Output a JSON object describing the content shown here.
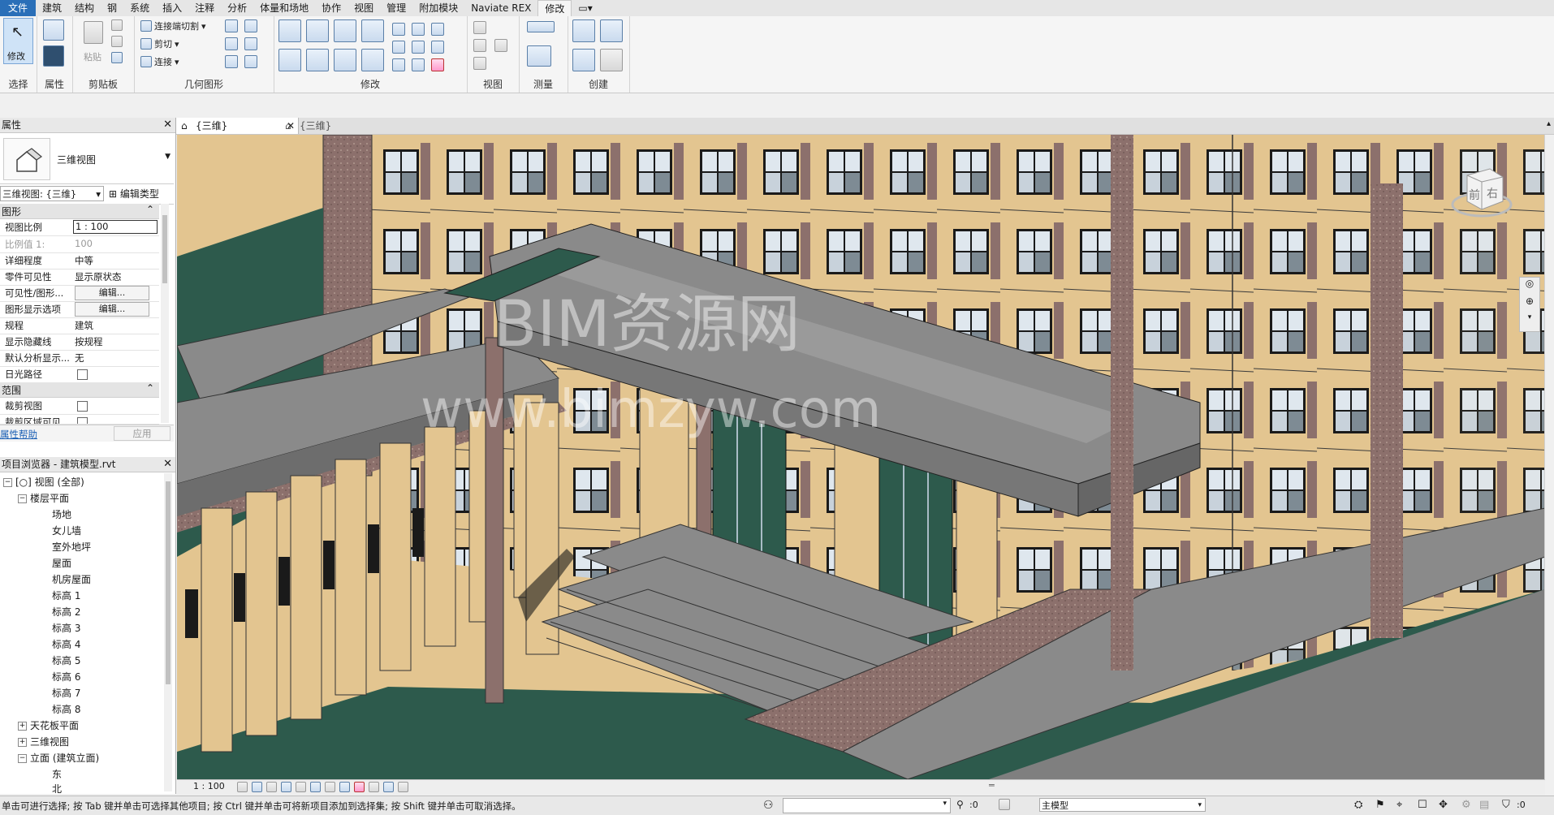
{
  "menu_tabs": [
    "文件",
    "建筑",
    "结构",
    "钢",
    "系统",
    "插入",
    "注释",
    "分析",
    "体量和场地",
    "协作",
    "视图",
    "管理",
    "附加模块",
    "Naviate REX",
    "修改"
  ],
  "ribbon": {
    "panels": {
      "select": "选择",
      "properties": "属性",
      "clipboard": "剪贴板",
      "geometry": "几何图形",
      "modify": "修改",
      "view": "视图",
      "measure": "测量",
      "create": "创建"
    },
    "modify_button": "修改",
    "paste_label": "粘贴",
    "cope": "连接端切割",
    "cut": "剪切",
    "join": "连接"
  },
  "properties_panel": {
    "title": "属性",
    "type_name": "三维视图",
    "type_selector": "三维视图: {三维}",
    "edit_type": "编辑类型",
    "section_graphics": "图形",
    "section_range": "范围",
    "rows": [
      {
        "key": "视图比例",
        "value": "1 : 100"
      },
      {
        "key": "比例值 1:",
        "value": "100"
      },
      {
        "key": "详细程度",
        "value": "中等"
      },
      {
        "key": "零件可见性",
        "value": "显示原状态"
      },
      {
        "key": "可见性/图形...",
        "value": "编辑..."
      },
      {
        "key": "图形显示选项",
        "value": "编辑..."
      },
      {
        "key": "规程",
        "value": "建筑"
      },
      {
        "key": "显示隐藏线",
        "value": "按规程"
      },
      {
        "key": "默认分析显示...",
        "value": "无"
      },
      {
        "key": "日光路径",
        "value": ""
      }
    ],
    "range_rows": [
      {
        "key": "裁剪视图"
      },
      {
        "key": "裁剪区域可见"
      }
    ],
    "help_link": "属性帮助",
    "apply": "应用"
  },
  "project_browser": {
    "title": "项目浏览器 - 建筑模型.rvt",
    "root": "视图 (全部)",
    "floor_plans": "楼层平面",
    "floor_items": [
      "场地",
      "女儿墙",
      "室外地坪",
      "屋面",
      "机房屋面",
      "标高 1",
      "标高 2",
      "标高 3",
      "标高 4",
      "标高 5",
      "标高 6",
      "标高 7",
      "标高 8"
    ],
    "ceiling_plans": "天花板平面",
    "views_3d": "三维视图",
    "elevations": "立面 (建筑立面)",
    "elev_items": [
      "东",
      "北"
    ]
  },
  "view_tabs": [
    "{三维}",
    "{三维}"
  ],
  "view_scale": "1 : 100",
  "watermark": [
    "BIM资源网",
    "www.bimzyw.com"
  ],
  "viewcube_labels": [
    "前",
    "右"
  ],
  "status": {
    "hint": "单击可进行选择; 按 Tab 键并单击可选择其他项目; 按 Ctrl 键并单击可将新项目添加到选择集; 按 Shift 键并单击可取消选择。",
    "worksets": ":0",
    "model": "主模型",
    "filter": ":0"
  },
  "colors": {
    "wall_tan": "#e3c590",
    "glass_green": "#2d5a4c",
    "stone": "#8c706c",
    "roof_grey": "#8a8a8a"
  }
}
